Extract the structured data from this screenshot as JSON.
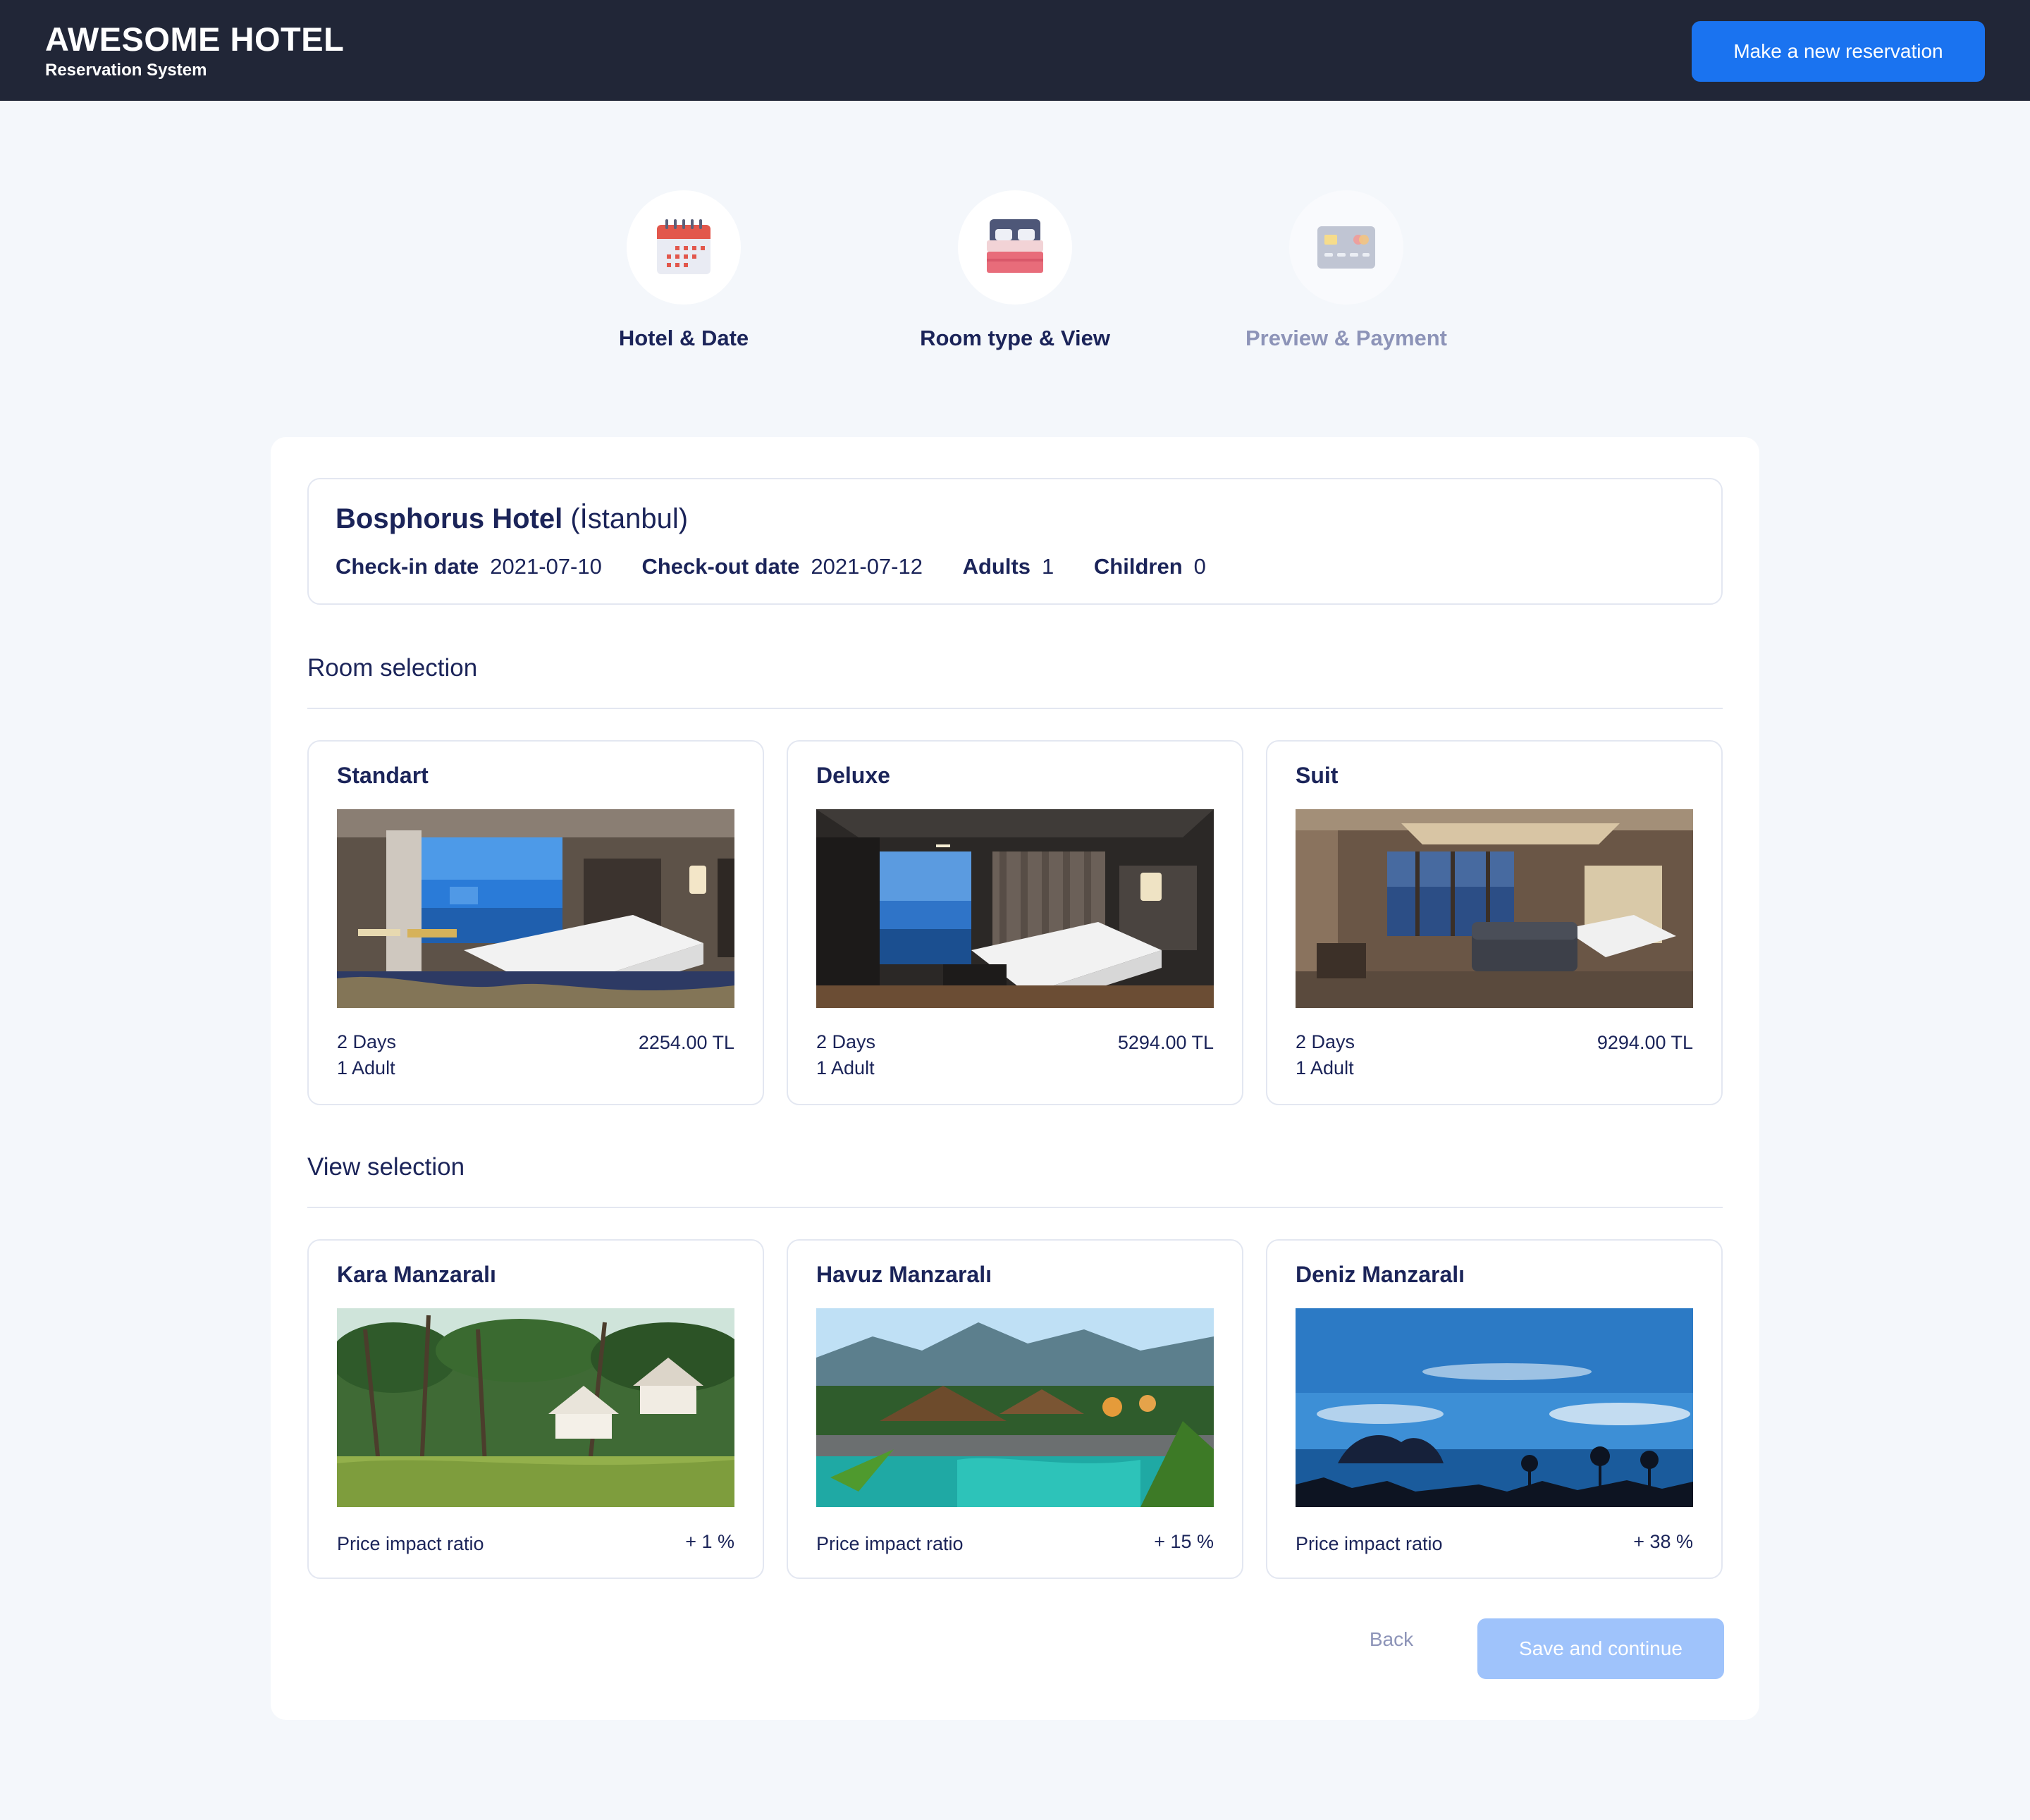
{
  "header": {
    "title": "AWESOME HOTEL",
    "subtitle": "Reservation System",
    "new_reservation_label": "Make a new reservation"
  },
  "steps": [
    {
      "label": "Hotel & Date",
      "icon": "calendar-icon",
      "state": "done"
    },
    {
      "label": "Room type & View",
      "icon": "bed-icon",
      "state": "active"
    },
    {
      "label": "Preview & Payment",
      "icon": "credit-card-icon",
      "state": "inactive"
    }
  ],
  "summary": {
    "hotel_name": "Bosphorus Hotel",
    "hotel_city": "(İstanbul)",
    "checkin_label": "Check-in date",
    "checkin_value": "2021-07-10",
    "checkout_label": "Check-out date",
    "checkout_value": "2021-07-12",
    "adults_label": "Adults",
    "adults_value": "1",
    "children_label": "Children",
    "children_value": "0"
  },
  "room_section_title": "Room selection",
  "rooms": [
    {
      "name": "Standart",
      "days": "2 Days",
      "guests": "1 Adult",
      "price": "2254.00 TL"
    },
    {
      "name": "Deluxe",
      "days": "2 Days",
      "guests": "1 Adult",
      "price": "5294.00 TL"
    },
    {
      "name": "Suit",
      "days": "2 Days",
      "guests": "1 Adult",
      "price": "9294.00 TL"
    }
  ],
  "view_section_title": "View selection",
  "views": [
    {
      "name": "Kara Manzaralı",
      "ratio_label": "Price impact ratio",
      "ratio_value": "+ 1 %"
    },
    {
      "name": "Havuz Manzaralı",
      "ratio_label": "Price impact ratio",
      "ratio_value": "+ 15 %"
    },
    {
      "name": "Deniz Manzaralı",
      "ratio_label": "Price impact ratio",
      "ratio_value": "+ 38 %"
    }
  ],
  "actions": {
    "back_label": "Back",
    "save_label": "Save and continue"
  },
  "colors": {
    "header_bg": "#212637",
    "primary": "#1a73f0",
    "primary_disabled": "#9fc3fb",
    "text_dark": "#1b2459",
    "text_muted": "#8d94b8",
    "page_bg": "#f4f7fb"
  }
}
